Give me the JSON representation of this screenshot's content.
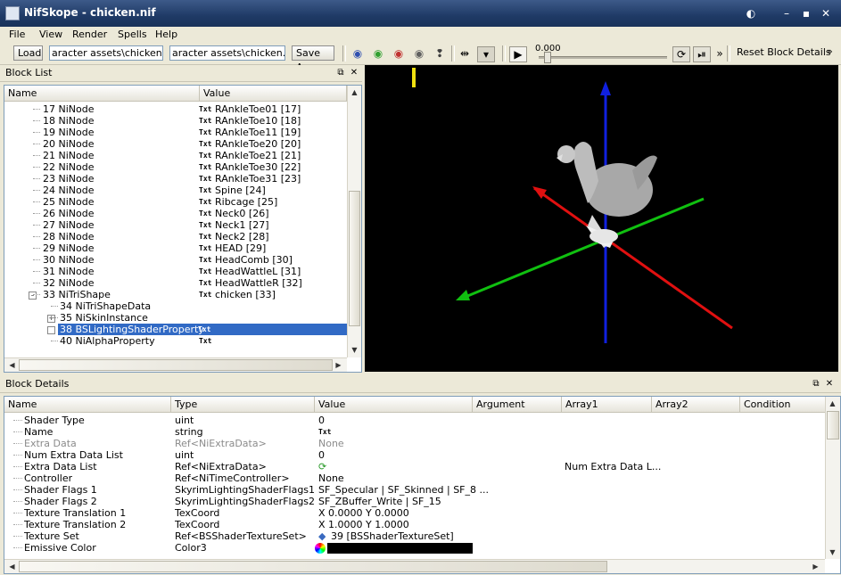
{
  "window": {
    "title": "NifSkope - chicken.nif"
  },
  "menu": [
    "File",
    "View",
    "Render",
    "Spells",
    "Help"
  ],
  "toolbar": {
    "load_label": "Load",
    "path_in": "aracter assets\\chicken.nif",
    "path_out": "aracter assets\\chicken.nif",
    "save_as_label": "Save As",
    "time_value": "0.000",
    "reset_label": "Reset Block Details",
    "more": "»"
  },
  "block_list": {
    "title": "Block List",
    "col_name": "Name",
    "col_value": "Value",
    "rows": [
      {
        "name": "17 NiNode",
        "value": "RAnkleToe01 [17]"
      },
      {
        "name": "18 NiNode",
        "value": "RAnkleToe10 [18]"
      },
      {
        "name": "19 NiNode",
        "value": "RAnkleToe11 [19]"
      },
      {
        "name": "20 NiNode",
        "value": "RAnkleToe20 [20]"
      },
      {
        "name": "21 NiNode",
        "value": "RAnkleToe21 [21]"
      },
      {
        "name": "22 NiNode",
        "value": "RAnkleToe30 [22]"
      },
      {
        "name": "23 NiNode",
        "value": "RAnkleToe31 [23]"
      },
      {
        "name": "24 NiNode",
        "value": "Spine [24]"
      },
      {
        "name": "25 NiNode",
        "value": "Ribcage [25]"
      },
      {
        "name": "26 NiNode",
        "value": "Neck0 [26]"
      },
      {
        "name": "27 NiNode",
        "value": "Neck1 [27]"
      },
      {
        "name": "28 NiNode",
        "value": "Neck2 [28]"
      },
      {
        "name": "29 NiNode",
        "value": "HEAD [29]"
      },
      {
        "name": "30 NiNode",
        "value": "HeadComb [30]"
      },
      {
        "name": "31 NiNode",
        "value": "HeadWattleL [31]"
      },
      {
        "name": "32 NiNode",
        "value": "HeadWattleR [32]"
      },
      {
        "name": "33 NiTriShape",
        "value": "chicken [33]"
      },
      {
        "name": "34 NiTriShapeData",
        "value": ""
      },
      {
        "name": "35 NiSkinInstance",
        "value": ""
      },
      {
        "name": "38 BSLightingShaderProperty",
        "value": ""
      },
      {
        "name": "40 NiAlphaProperty",
        "value": ""
      }
    ],
    "txt_tag": "Txt"
  },
  "block_details": {
    "title": "Block Details",
    "columns": [
      "Name",
      "Type",
      "Value",
      "Argument",
      "Array1",
      "Array2",
      "Condition"
    ],
    "rows": [
      {
        "name": "Shader Type",
        "type": "uint",
        "value": "0",
        "array1": ""
      },
      {
        "name": "Name",
        "type": "string",
        "value": "Txt",
        "array1": ""
      },
      {
        "name": "Extra Data",
        "type": "Ref<NiExtraData>",
        "value": "None",
        "array1": ""
      },
      {
        "name": "Num Extra Data List",
        "type": "uint",
        "value": "0",
        "array1": ""
      },
      {
        "name": "Extra Data List",
        "type": "Ref<NiExtraData>",
        "value": "",
        "array1": "Num Extra Data L..."
      },
      {
        "name": "Controller",
        "type": "Ref<NiTimeController>",
        "value": "None",
        "array1": ""
      },
      {
        "name": "Shader Flags 1",
        "type": "SkyrimLightingShaderFlags1",
        "value": "SF_Specular | SF_Skinned | SF_8 ...",
        "array1": ""
      },
      {
        "name": "Shader Flags 2",
        "type": "SkyrimLightingShaderFlags2",
        "value": "SF_ZBuffer_Write | SF_15",
        "array1": ""
      },
      {
        "name": "Texture Translation 1",
        "type": "TexCoord",
        "value": "X 0.0000 Y 0.0000",
        "array1": ""
      },
      {
        "name": "Texture Translation 2",
        "type": "TexCoord",
        "value": "X 1.0000 Y 1.0000",
        "array1": ""
      },
      {
        "name": "Texture Set",
        "type": "Ref<BSShaderTextureSet>",
        "value": "39 [BSShaderTextureSet]",
        "array1": ""
      },
      {
        "name": "Emissive Color",
        "type": "Color3",
        "value": "",
        "array1": ""
      }
    ]
  },
  "colors": {
    "selection": "#316ac5",
    "viewport_bg": "#000000",
    "axis_x": "#e01010",
    "axis_y": "#10c010",
    "axis_z": "#1020e0"
  }
}
